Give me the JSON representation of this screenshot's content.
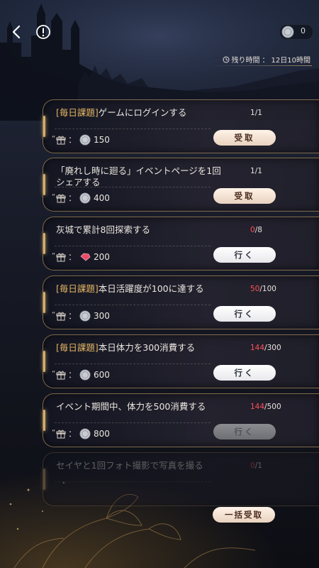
{
  "header": {
    "coin_count": "0",
    "timer_label": "残り時間",
    "timer_sep": "：",
    "timer_value": "12日10時間"
  },
  "tasks": [
    {
      "tag": "[毎日課題]",
      "text": "ゲームにログインする",
      "cur": "1",
      "total": "/1",
      "reward_icon": "silver-coin-icon",
      "reward_qty": "150",
      "button": "受取",
      "button_type": "receive"
    },
    {
      "tag": "",
      "text": "「廃れし時に廻る」イベントページを1回シェアする",
      "cur": "1",
      "total": "/1",
      "reward_icon": "silver-coin-icon",
      "reward_qty": "400",
      "button": "受取",
      "button_type": "receive"
    },
    {
      "tag": "",
      "text": "灰城で累計8回探索する",
      "cur": "0",
      "total": "/8",
      "reward_icon": "ruby-gem-icon",
      "reward_qty": "200",
      "button": "行く",
      "button_type": "go"
    },
    {
      "tag": "[毎日課題]",
      "text": "本日活躍度が100に達する",
      "cur": "50",
      "total": "/100",
      "reward_icon": "silver-coin-icon",
      "reward_qty": "300",
      "button": "行く",
      "button_type": "go"
    },
    {
      "tag": "[毎日課題]",
      "text": "本日体力を300消費する",
      "cur": "144",
      "total": "/300",
      "reward_icon": "silver-coin-icon",
      "reward_qty": "600",
      "button": "行く",
      "button_type": "go"
    },
    {
      "tag": "",
      "text": "イベント期間中、体力を500消費する",
      "cur": "144",
      "total": "/500",
      "reward_icon": "silver-coin-icon",
      "reward_qty": "800",
      "button": "行く",
      "button_type": "disabled"
    },
    {
      "tag": "",
      "text": "セイヤと1回フォト撮影で写真を撮る",
      "cur": "0",
      "total": "/1",
      "reward_icon": "",
      "reward_qty": "",
      "button": "",
      "button_type": "faded"
    }
  ],
  "reward_colon": "：",
  "collect_all_label": "一括受取",
  "colors": {
    "accent_gold": "#e3b463",
    "progress_red": "#ff4f5a",
    "receive_button": "#f3e2d3"
  }
}
